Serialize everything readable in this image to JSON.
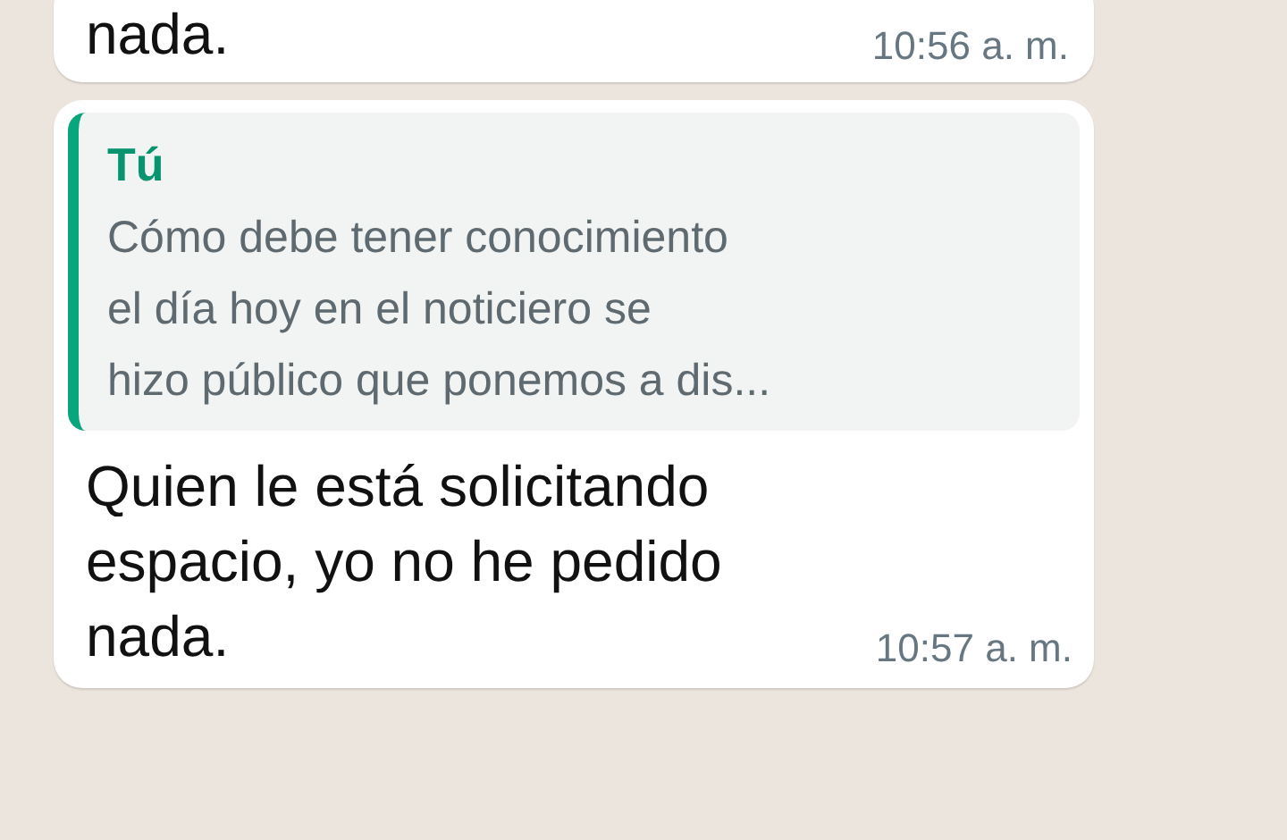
{
  "messages": [
    {
      "kind": "plain",
      "text_lines": [
        "nada."
      ],
      "time": "10:56 a. m."
    },
    {
      "kind": "reply",
      "quote": {
        "author": "Tú",
        "text_lines": [
          "Cómo debe tener conocimiento",
          "el día hoy en el noticiero se",
          "hizo público que ponemos a dis..."
        ]
      },
      "text_lines": [
        "Quien le está solicitando",
        "espacio, yo no he pedido",
        "nada."
      ],
      "time": "10:57 a. m."
    }
  ]
}
